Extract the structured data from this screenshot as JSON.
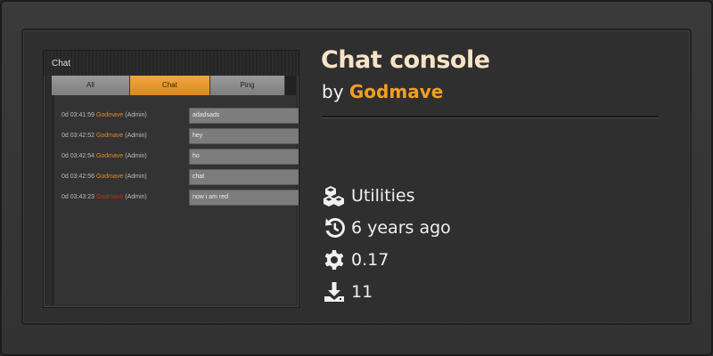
{
  "screenshot": {
    "window_title": "Chat",
    "tabs": [
      {
        "label": "All",
        "active": false
      },
      {
        "label": "Chat",
        "active": true
      },
      {
        "label": "Ping",
        "active": false
      }
    ],
    "messages": [
      {
        "time": "0d 03:41:59",
        "user": "Godmave",
        "role": "(Admin)",
        "text": "adadsads",
        "user_color": "orange"
      },
      {
        "time": "0d 03:42:52",
        "user": "Godmave",
        "role": "(Admin)",
        "text": "hey",
        "user_color": "orange"
      },
      {
        "time": "0d 03:42:54",
        "user": "Godmave",
        "role": "(Admin)",
        "text": "ho",
        "user_color": "orange"
      },
      {
        "time": "0d 03:42:56",
        "user": "Godmave",
        "role": "(Admin)",
        "text": "chat",
        "user_color": "orange"
      },
      {
        "time": "0d 03:43:23",
        "user": "Godmave",
        "role": "(Admin)",
        "text": "now i am red",
        "user_color": "red"
      }
    ]
  },
  "mod": {
    "title": "Chat console",
    "by_prefix": "by",
    "author": "Godmave",
    "category": "Utilities",
    "updated": "6 years ago",
    "version": "0.17",
    "downloads": "11"
  },
  "icons": {
    "category": "cubes-icon",
    "updated": "history-icon",
    "version": "gear-icon",
    "downloads": "download-icon"
  },
  "colors": {
    "accent": "#f0a020",
    "title": "#f7e3c6",
    "red_user": "#dd2222"
  }
}
